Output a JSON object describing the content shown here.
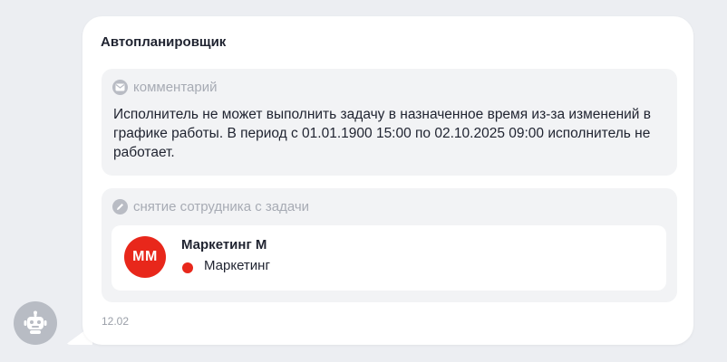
{
  "message": {
    "sender": "Автопланировщик",
    "time": "12.02"
  },
  "comment": {
    "header": "комментарий",
    "icon": "envelope-icon",
    "text": "Исполнитель не может выполнить задачу в назначенное время из-за изменений в графике работы. В период с 01.01.1900 15:00 по 02.10.2025 09:00 исполнитель не работает."
  },
  "removal": {
    "header": "снятие сотрудника с задачи",
    "icon": "pencil-icon",
    "employee": {
      "initials": "ММ",
      "name": "Маркетинг М",
      "department": "Маркетинг",
      "avatar_color": "#e8271b",
      "status_color": "#e8271b"
    }
  },
  "bot": {
    "icon": "robot-icon"
  },
  "colors": {
    "page_background": "#eceef2",
    "card_background": "#ffffff",
    "block_background": "#f2f3f5",
    "accent_red": "#e8271b",
    "muted_text": "#a7abb4"
  }
}
